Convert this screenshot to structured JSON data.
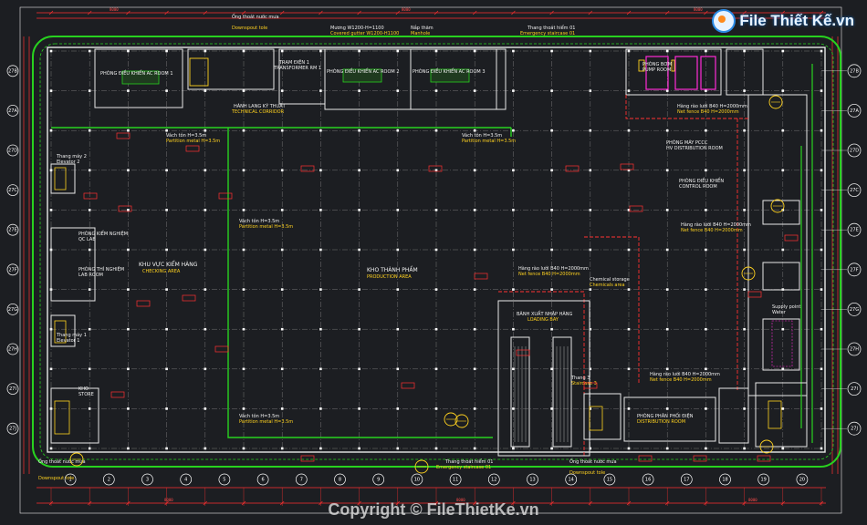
{
  "watermark": {
    "brand": "File Thiết Kế.vn",
    "copyright": "Copyright © FileThietKe.vn"
  },
  "colors": {
    "background": "#1c1e22",
    "grid": "#8a8a8a",
    "wall": "#e8e8e8",
    "green": "#28d21f",
    "red": "#ff3131",
    "magenta": "#ff2bd6",
    "yellow": "#ffd21f",
    "label": "#f0f0f0"
  },
  "plan": {
    "grid_cols": 20,
    "grid_rows": 10,
    "dimension_text": "8000",
    "axes_right": [
      "27B",
      "27A",
      "27D",
      "27C",
      "27E",
      "27F",
      "27G",
      "27H",
      "27I",
      "27J"
    ],
    "axes_bottom": [
      "1",
      "2",
      "3",
      "4",
      "5",
      "6",
      "7",
      "8",
      "9",
      "10",
      "11",
      "12",
      "13",
      "14",
      "15",
      "16",
      "17",
      "18",
      "19",
      "20"
    ],
    "labels": {
      "stair_2": "Thang máy 2",
      "elevator_2": "Elevator 2",
      "qc_room": "PHÒNG KIỂM NGHIỆM",
      "qc_room_en": "QC LAB",
      "lab_room": "PHÒNG THÍ NGHIỆM",
      "lab_room_en": "LAB ROOM",
      "stair_1": "Thang máy 1",
      "elevator_1": "Elevator 1",
      "store": "KHO",
      "store_en": "STORE",
      "checking_area": "KHU VỰC KIỂM HÀNG",
      "checking_area_en": "CHECKING AREA",
      "product_store": "KHO THÀNH PHẨM",
      "product_store_en": "PRODUCTION AREA",
      "loading_bay": "BÃNH XUẤT NHẬP HÀNG",
      "loading_bay_en": "LOADING BAY",
      "ahu_1": "PHÒNG ĐIỀU KHIỂN AC ROOM 1",
      "ahu_2": "PHÒNG ĐIỀU KHIỂN AC ROOM 2",
      "ahu_3": "PHÒNG ĐIỀU KHIỂN AC ROOM 3",
      "transformer": "TRẠM ĐIỆN 1",
      "transformer_en": "TRANSFORMER RM 1",
      "technical_corridor": "HÀNH LANG KỸ THUẬT",
      "technical_corridor_en": "TECHNICAL CORRIDOR",
      "pump_room": "PHÒNG BƠM",
      "pump_room_en": "PUMP ROOM",
      "hv_room": "PHÒNG MÁY PCCC",
      "hv_room_en": "HV DISTRIBUTION ROOM",
      "control_room": "PHÒNG ĐIỀU KHIỂN",
      "control_room_en": "CONTROL ROOM",
      "partition_1": "Vách tôn H=3.5m",
      "partition_1_en": "Partition metal H=3.5m",
      "partition_2": "Vách tôn H=3.5m",
      "partition_2_en": "Partition metal H=3.5m",
      "partition_3": "Vách tôn H=3.5m",
      "partition_3_en": "Partition metal H=3.5m",
      "net_fence": "Hàng rào lưới B40 H=2000mm",
      "net_fence_en": "Net fence B40 H=2000mm",
      "net_fence_2": "Hàng rào lưới B40 H=2000mm",
      "net_fence_2_en": "Net fence B40 H=2000mm",
      "downspout_1": "Ống thoát nước mưa",
      "downspout_1_en": "Downspout tole",
      "downspout_2": "Ống thoát nước mưa",
      "downspout_2_en": "Downspout tole",
      "gutter": "Mương W1200-H=1100",
      "gutter_en": "Covered gutter W1200-H1100",
      "manhole": "Nắp thăm",
      "manhole_en": "Manhole",
      "stair_3": "Thang 3",
      "stair_3_en": "Staircase 3",
      "emergency_stair": "Thang thoát hiểm 01",
      "emergency_stair_en": "Emergency staircase 01",
      "distribution": "PHÒNG PHÂN PHỐI ĐIỆN",
      "distribution_en": "DISTRIBUTION ROOM",
      "supply_point": "Supply point",
      "supply_point_en": "Water",
      "chemical": "Chemical storage",
      "chemical_en": "Chemicals area"
    }
  }
}
